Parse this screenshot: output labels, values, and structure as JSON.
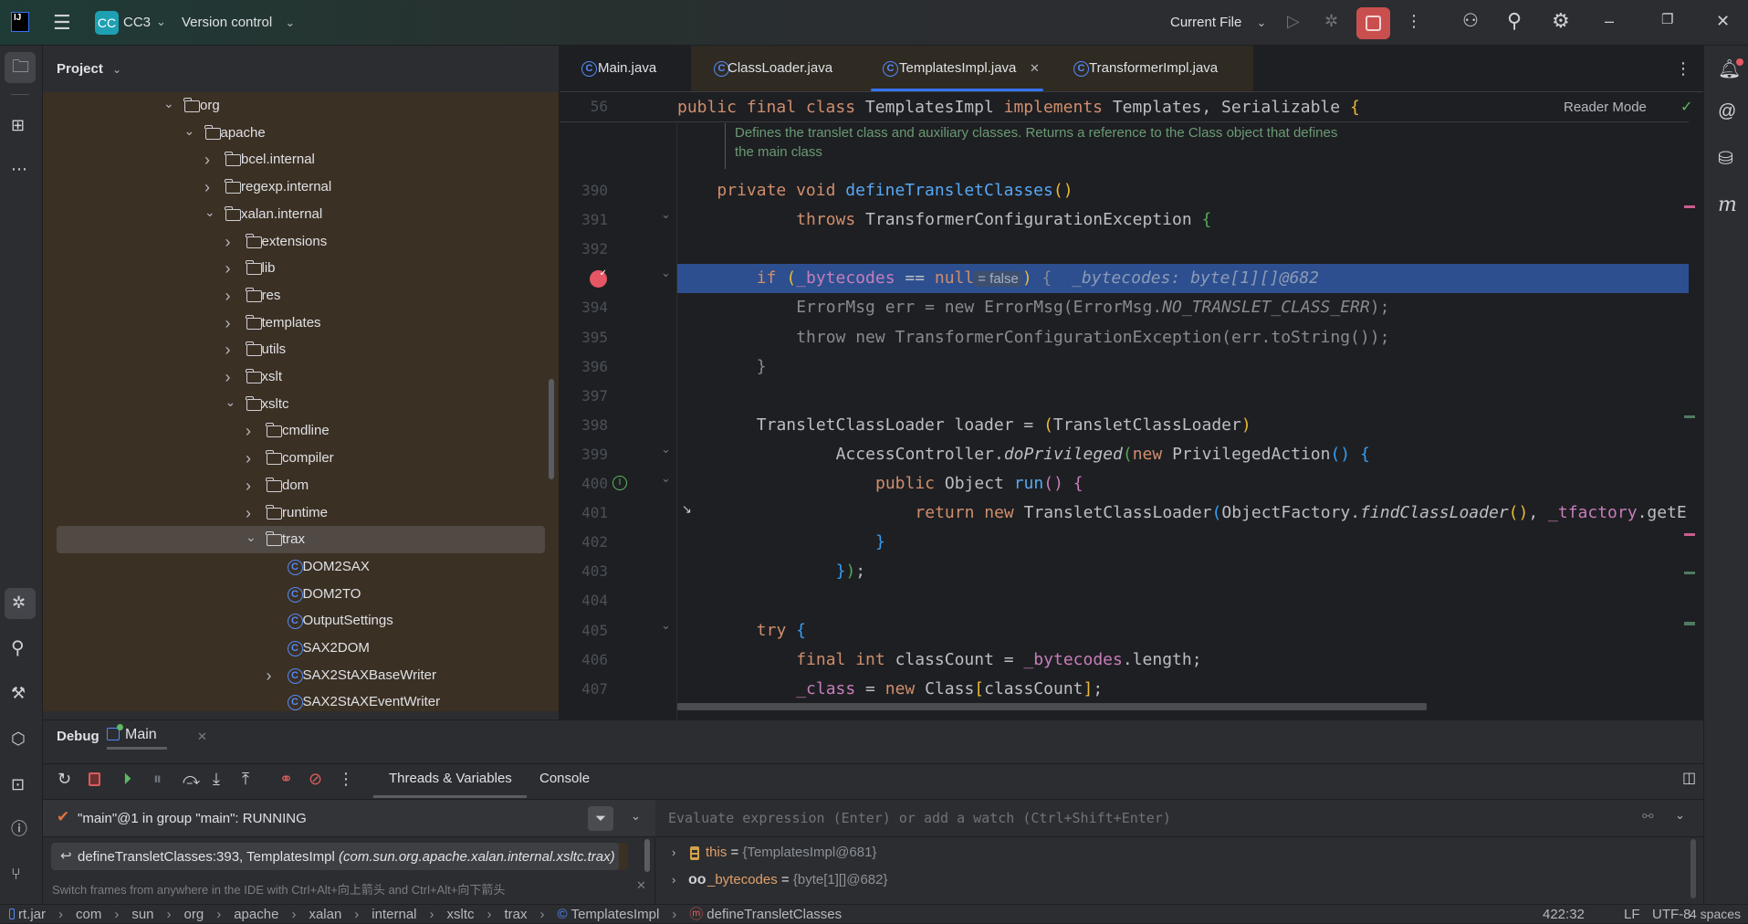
{
  "titlebar": {
    "project_badge": "CC",
    "project_name": "CC3",
    "vcs_label": "Version control",
    "run_config": "Current File",
    "icons": [
      "intellij-logo-icon",
      "hamburger-menu-icon",
      "run-icon",
      "debug-icon",
      "stop-icon",
      "more-icon",
      "add-user-icon",
      "search-icon",
      "gear-icon",
      "minimize-icon",
      "restore-icon",
      "close-icon"
    ]
  },
  "project_panel": {
    "title": "Project",
    "tree": [
      {
        "label": "org",
        "depth": 0,
        "kind": "folder",
        "expanded": true
      },
      {
        "label": "apache",
        "depth": 1,
        "kind": "folder",
        "expanded": true
      },
      {
        "label": "bcel.internal",
        "depth": 2,
        "kind": "folder",
        "expanded": false
      },
      {
        "label": "regexp.internal",
        "depth": 2,
        "kind": "folder",
        "expanded": false
      },
      {
        "label": "xalan.internal",
        "depth": 2,
        "kind": "folder",
        "expanded": true
      },
      {
        "label": "extensions",
        "depth": 3,
        "kind": "folder",
        "expanded": false
      },
      {
        "label": "lib",
        "depth": 3,
        "kind": "folder",
        "expanded": false
      },
      {
        "label": "res",
        "depth": 3,
        "kind": "folder",
        "expanded": false
      },
      {
        "label": "templates",
        "depth": 3,
        "kind": "folder",
        "expanded": false
      },
      {
        "label": "utils",
        "depth": 3,
        "kind": "folder",
        "expanded": false
      },
      {
        "label": "xslt",
        "depth": 3,
        "kind": "folder",
        "expanded": false
      },
      {
        "label": "xsltc",
        "depth": 3,
        "kind": "folder",
        "expanded": true
      },
      {
        "label": "cmdline",
        "depth": 4,
        "kind": "folder",
        "expanded": false
      },
      {
        "label": "compiler",
        "depth": 4,
        "kind": "folder",
        "expanded": false
      },
      {
        "label": "dom",
        "depth": 4,
        "kind": "folder",
        "expanded": false
      },
      {
        "label": "runtime",
        "depth": 4,
        "kind": "folder",
        "expanded": false
      },
      {
        "label": "trax",
        "depth": 4,
        "kind": "folder",
        "expanded": true,
        "selected": true
      },
      {
        "label": "DOM2SAX",
        "depth": 5,
        "kind": "class"
      },
      {
        "label": "DOM2TO",
        "depth": 5,
        "kind": "class"
      },
      {
        "label": "OutputSettings",
        "depth": 5,
        "kind": "class"
      },
      {
        "label": "SAX2DOM",
        "depth": 5,
        "kind": "class"
      },
      {
        "label": "SAX2StAXBaseWriter",
        "depth": 5,
        "kind": "class",
        "expanded": false
      },
      {
        "label": "SAX2StAXEventWriter",
        "depth": 5,
        "kind": "class"
      }
    ]
  },
  "editor": {
    "tabs": [
      {
        "label": "Main.java",
        "active": false
      },
      {
        "label": "ClassLoader.java",
        "active": false
      },
      {
        "label": "TemplatesImpl.java",
        "active": true
      },
      {
        "label": "TransformerImpl.java",
        "active": false
      }
    ],
    "reader_mode": "Reader Mode",
    "sticky_line": {
      "num": "56",
      "tokens": [
        [
          "kw",
          "public final class "
        ],
        [
          "tx",
          "TemplatesImpl "
        ],
        [
          "kw",
          "implements "
        ],
        [
          "tx",
          "Templates, Serializable "
        ],
        [
          "b1",
          "{"
        ]
      ]
    },
    "doc_comment": [
      "Defines the translet class and auxiliary classes. Returns a reference to the Class object that defines",
      "the main class"
    ],
    "lines": [
      {
        "num": "390",
        "indent": 1,
        "tokens": [
          [
            "kw",
            "private "
          ],
          [
            "kw",
            "void "
          ],
          [
            "fn",
            "defineTransletClasses"
          ],
          [
            "b1",
            "()"
          ]
        ]
      },
      {
        "num": "391",
        "indent": 3,
        "fold": true,
        "tokens": [
          [
            "kw",
            "throws "
          ],
          [
            "tx",
            "TransformerConfigurationException "
          ],
          [
            "b2",
            "{"
          ]
        ]
      },
      {
        "num": "392",
        "indent": 0,
        "tokens": []
      },
      {
        "num": "393",
        "indent": 2,
        "fold": true,
        "breakpoint": true,
        "current": true,
        "tokens": [
          [
            "kw",
            "if "
          ],
          [
            "b1",
            "("
          ],
          [
            "fld",
            "_bytecodes"
          ],
          [
            "tx",
            " == "
          ],
          [
            "kw",
            "null"
          ],
          [
            "inl",
            "= false"
          ],
          [
            "b1",
            ")"
          ],
          [
            "dim",
            " { "
          ],
          [
            "hint",
            " _bytecodes: byte[1][]@682"
          ]
        ]
      },
      {
        "num": "394",
        "indent": 3,
        "tokens": [
          [
            "dim",
            "ErrorMsg err = new ErrorMsg(ErrorMsg."
          ],
          [
            "dim it",
            "NO_TRANSLET_CLASS_ERR"
          ],
          [
            "dim",
            ");"
          ]
        ]
      },
      {
        "num": "395",
        "indent": 3,
        "tokens": [
          [
            "dim",
            "throw new TransformerConfigurationException(err.toString());"
          ]
        ]
      },
      {
        "num": "396",
        "indent": 2,
        "tokens": [
          [
            "dim",
            "}"
          ]
        ]
      },
      {
        "num": "397",
        "indent": 0,
        "tokens": []
      },
      {
        "num": "398",
        "indent": 2,
        "tokens": [
          [
            "tx",
            "TransletClassLoader loader = "
          ],
          [
            "b1",
            "("
          ],
          [
            "tx",
            "TransletClassLoader"
          ],
          [
            "b1",
            ")"
          ]
        ]
      },
      {
        "num": "399",
        "indent": 4,
        "fold": true,
        "tokens": [
          [
            "tx",
            "AccessController."
          ],
          [
            "it",
            "doPrivileged"
          ],
          [
            "b2",
            "("
          ],
          [
            "kw",
            "new "
          ],
          [
            "tx",
            "PrivilegedAction"
          ],
          [
            "b3",
            "() {"
          ]
        ]
      },
      {
        "num": "400",
        "indent": 5,
        "fold": true,
        "implements": true,
        "tokens": [
          [
            "kw",
            "public "
          ],
          [
            "tx",
            "Object "
          ],
          [
            "fn",
            "run"
          ],
          [
            "fld",
            "() {"
          ]
        ]
      },
      {
        "num": "401",
        "indent": 6,
        "cursor": true,
        "tokens": [
          [
            "kw",
            "return new "
          ],
          [
            "tx",
            "TransletClassLoader"
          ],
          [
            "b3",
            "("
          ],
          [
            "tx",
            "ObjectFactory."
          ],
          [
            "it",
            "findClassLoader"
          ],
          [
            "b1",
            "()"
          ],
          [
            "tx",
            ", "
          ],
          [
            "fld",
            "_tfactory"
          ],
          [
            "tx",
            ".getE"
          ]
        ]
      },
      {
        "num": "402",
        "indent": 5,
        "tokens": [
          [
            "b3",
            "}"
          ]
        ]
      },
      {
        "num": "403",
        "indent": 4,
        "tokens": [
          [
            "b3",
            "}"
          ],
          [
            "b2",
            ")"
          ],
          [
            "tx",
            ";"
          ]
        ]
      },
      {
        "num": "404",
        "indent": 0,
        "tokens": []
      },
      {
        "num": "405",
        "indent": 2,
        "fold": true,
        "tokens": [
          [
            "kw",
            "try "
          ],
          [
            "b3",
            "{"
          ]
        ]
      },
      {
        "num": "406",
        "indent": 3,
        "tokens": [
          [
            "kw",
            "final "
          ],
          [
            "kw",
            "int "
          ],
          [
            "tx",
            "classCount = "
          ],
          [
            "fld",
            "_bytecodes"
          ],
          [
            "tx",
            ".length;"
          ]
        ]
      },
      {
        "num": "407",
        "indent": 3,
        "tokens": [
          [
            "fld",
            "_class"
          ],
          [
            "tx",
            " = "
          ],
          [
            "kw",
            "new "
          ],
          [
            "tx",
            "Class"
          ],
          [
            "b1",
            "["
          ],
          [
            "tx",
            "classCount"
          ],
          [
            "b1",
            "]"
          ],
          [
            "tx",
            ";"
          ]
        ]
      }
    ]
  },
  "debug": {
    "title": "Debug",
    "session_tab": "Main",
    "subtabs": [
      {
        "label": "Threads & Variables",
        "active": true
      },
      {
        "label": "Console",
        "active": false
      }
    ],
    "thread": "\"main\"@1 in group \"main\": RUNNING",
    "frame": {
      "method": "defineTransletClasses:393, TemplatesImpl",
      "package": "(com.sun.org.apache.xalan.internal.xsltc.trax)"
    },
    "hint": "Switch frames from anywhere in the IDE with Ctrl+Alt+向上箭头 and Ctrl+Alt+向下箭头",
    "evaluate_placeholder": "Evaluate expression (Enter) or add a watch (Ctrl+Shift+Enter)",
    "variables": [
      {
        "name": "this",
        "value": "{TemplatesImpl@681}",
        "icon": "object-icon"
      },
      {
        "name": "_bytecodes",
        "value": "{byte[1][]@682}",
        "icon": "watch-glasses-icon"
      }
    ]
  },
  "statusbar": {
    "breadcrumbs": [
      "rt.jar",
      "com",
      "sun",
      "org",
      "apache",
      "xalan",
      "internal",
      "xsltc",
      "trax",
      "TemplatesImpl",
      "defineTransletClasses"
    ],
    "position": "422:32",
    "line_ending": "LF",
    "encoding": "UTF-8",
    "indent": "4 spaces"
  },
  "colors": {
    "accent": "#3574f0",
    "stop": "#c94f4f",
    "breakpoint": "#e55765",
    "current_line": "#2d4f8f"
  }
}
